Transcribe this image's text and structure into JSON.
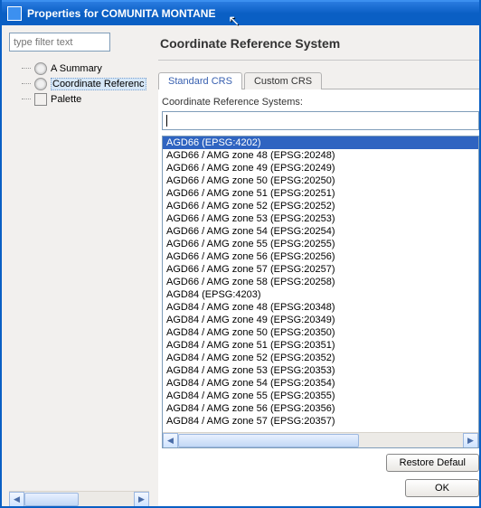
{
  "window": {
    "title": "Properties for COMUNITA MONTANE"
  },
  "left": {
    "filter_placeholder": "type filter text",
    "tree": {
      "summary": "A Summary",
      "crs": "Coordinate Referenc",
      "palette": "Palette"
    }
  },
  "right": {
    "heading": "Coordinate Reference System",
    "tabs": {
      "standard": "Standard CRS",
      "custom": "Custom CRS"
    },
    "label": "Coordinate Reference Systems:",
    "search_value": "",
    "list": [
      "AGD66 (EPSG:4202)",
      "AGD66 / AMG zone 48 (EPSG:20248)",
      "AGD66 / AMG zone 49 (EPSG:20249)",
      "AGD66 / AMG zone 50 (EPSG:20250)",
      "AGD66 / AMG zone 51 (EPSG:20251)",
      "AGD66 / AMG zone 52 (EPSG:20252)",
      "AGD66 / AMG zone 53 (EPSG:20253)",
      "AGD66 / AMG zone 54 (EPSG:20254)",
      "AGD66 / AMG zone 55 (EPSG:20255)",
      "AGD66 / AMG zone 56 (EPSG:20256)",
      "AGD66 / AMG zone 57 (EPSG:20257)",
      "AGD66 / AMG zone 58 (EPSG:20258)",
      "AGD84 (EPSG:4203)",
      "AGD84 / AMG zone 48 (EPSG:20348)",
      "AGD84 / AMG zone 49 (EPSG:20349)",
      "AGD84 / AMG zone 50 (EPSG:20350)",
      "AGD84 / AMG zone 51 (EPSG:20351)",
      "AGD84 / AMG zone 52 (EPSG:20352)",
      "AGD84 / AMG zone 53 (EPSG:20353)",
      "AGD84 / AMG zone 54 (EPSG:20354)",
      "AGD84 / AMG zone 55 (EPSG:20355)",
      "AGD84 / AMG zone 56 (EPSG:20356)",
      "AGD84 / AMG zone 57 (EPSG:20357)"
    ],
    "selected_index": 0
  },
  "buttons": {
    "restore": "Restore Defaul",
    "ok": "OK"
  }
}
